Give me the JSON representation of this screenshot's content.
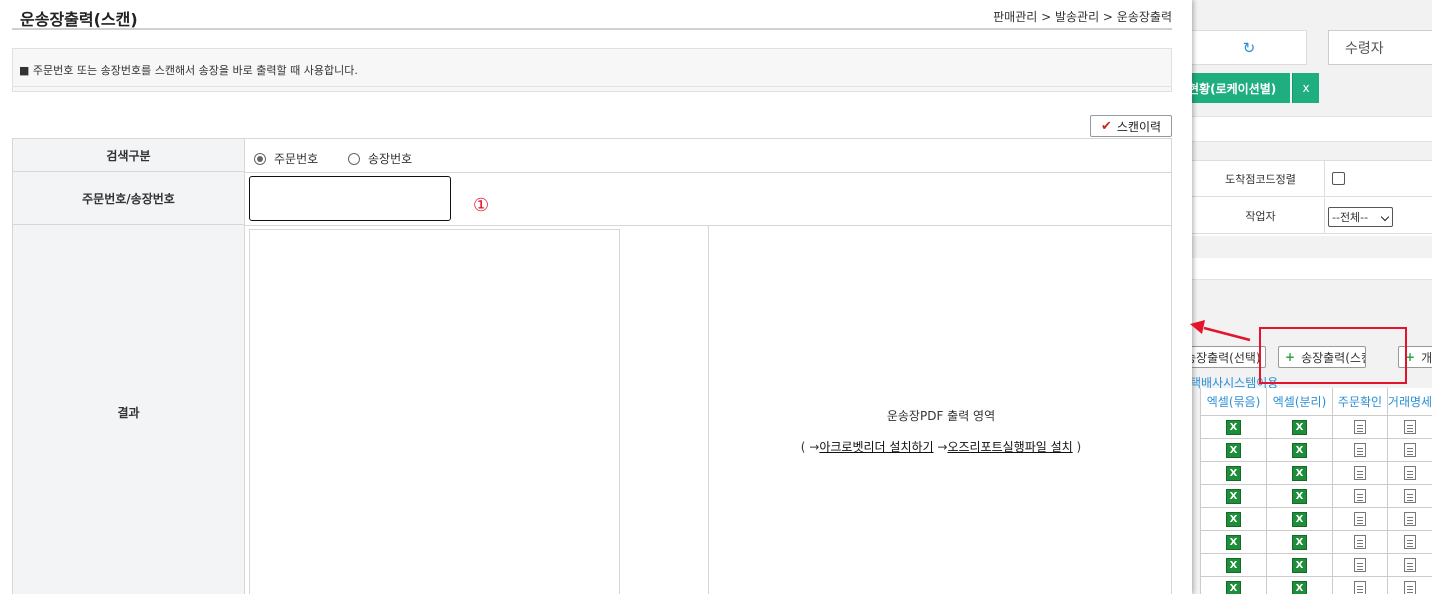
{
  "popup": {
    "title": "운송장출력(스캔)",
    "breadcrumb": "판매관리 > 발송관리 > 운송장출력",
    "notice": "■ 주문번호 또는 송장번호를 스캔해서 송장을 바로 출력할 때 사용합니다.",
    "scan_history_label": "스캔이력",
    "form": {
      "search_type_label": "검색구분",
      "options": [
        "주문번호",
        "송장번호"
      ],
      "selected_option": "주문번호",
      "number_label": "주문번호/송장번호",
      "number_value": "",
      "marker": "①",
      "result_label": "결과"
    },
    "pdf_area": {
      "title": "운송장PDF 출력 영역",
      "paren_open": "( →",
      "link1": "아크로벳리더 설치하기",
      "arrow2": " →",
      "link2": "오즈리포트실행파일 설치",
      "paren_close": " )"
    }
  },
  "background": {
    "receiver_placeholder": "수령자",
    "tab_label": "현황(로케이션별)",
    "tab_close": "x",
    "arrival_sort_label": "도착점코드정렬",
    "worker_label": "작업자",
    "worker_select": "--전체--",
    "buttons": [
      "송장출력(선택)",
      "송장출력(스캔)",
      "개"
    ],
    "sub_link": "택배사시스템이용",
    "columns": [
      "엑셀(묶음)",
      "엑셀(분리)",
      "주문확인",
      "거래명세"
    ],
    "row_count": 8
  }
}
